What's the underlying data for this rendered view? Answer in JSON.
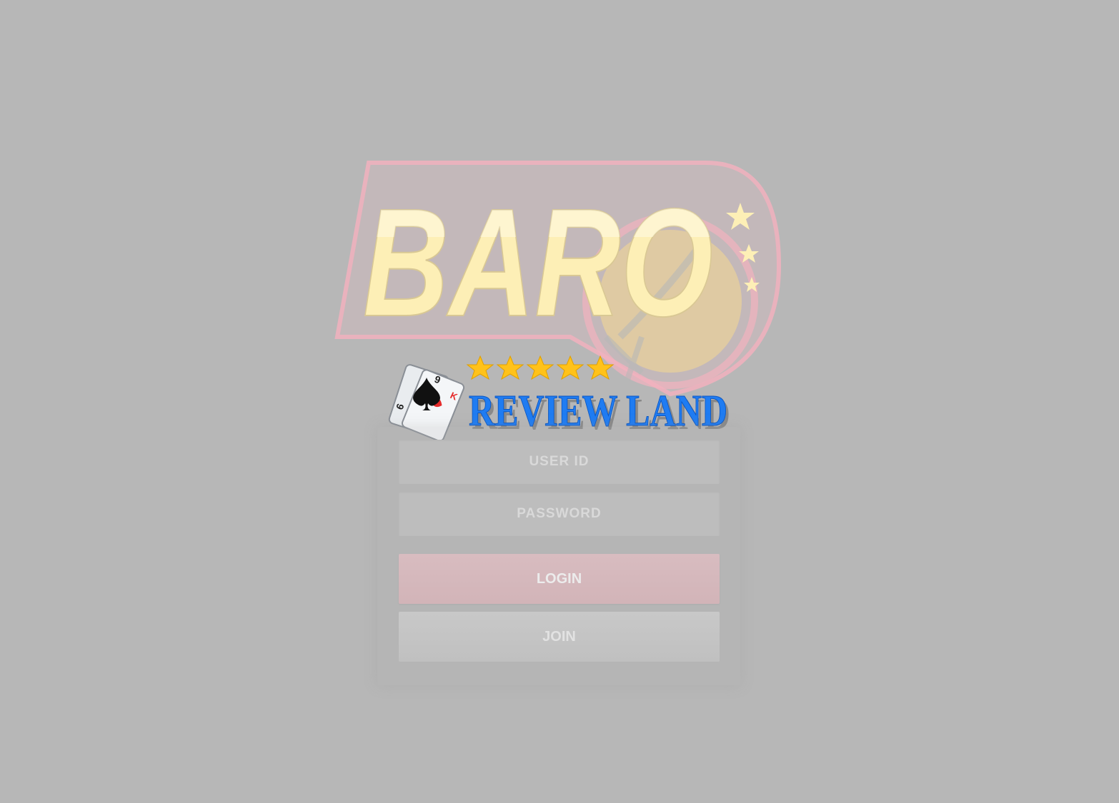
{
  "logo": {
    "brand_text": "BARO",
    "colors": {
      "outline": "#f2b2bf",
      "fill": "#fdefb6",
      "highlight": "#fffbe7"
    }
  },
  "watermark": {
    "text": "REVIEW LAND",
    "star_count": 5,
    "colors": {
      "star": "#ffc21a",
      "text": "#1f7cf2"
    },
    "icon": "playing-cards-icon"
  },
  "login_form": {
    "user_id_placeholder": "USER ID",
    "password_placeholder": "PASSWORD",
    "login_label": "LOGIN",
    "join_label": "JOIN"
  },
  "theme": {
    "background": "#b7b7b7",
    "login_button": "#d4b6ba",
    "join_button": "#c4c4c4"
  }
}
